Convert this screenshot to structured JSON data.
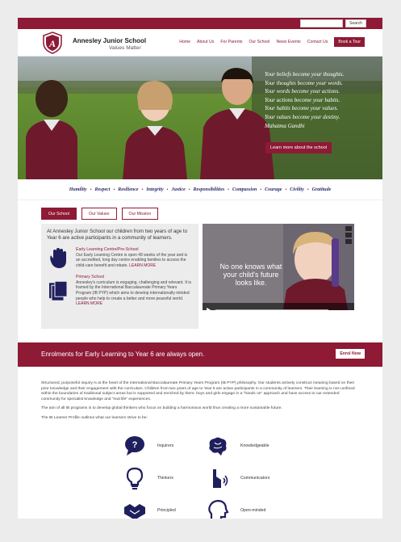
{
  "search": {
    "placeholder": "",
    "button_label": "Search"
  },
  "header": {
    "school_name": "Annesley Junior School",
    "tagline": "Values Matter",
    "crest_letter": "A"
  },
  "nav": {
    "items": [
      "Home",
      "About Us",
      "For Parents",
      "Our School",
      "News Events",
      "Contact Us"
    ],
    "cta_label": "Book a Tour"
  },
  "hero": {
    "quote_lines": [
      "Your beliefs become your thoughts.",
      "Your thoughts become your words.",
      "Your words become your actions.",
      "Your actions become your habits.",
      "Your habits become your values.",
      "Your values become your destiny."
    ],
    "attribution": "Mahatma Gandhi",
    "cta_label": "Learn more about the school"
  },
  "values": [
    "Humility",
    "Respect",
    "Resilience",
    "Integrity",
    "Justice",
    "Responsibilities",
    "Compassion",
    "Courage",
    "Civility",
    "Gratitude"
  ],
  "tabs": [
    "Our School",
    "Our Values",
    "Our Mission"
  ],
  "panel": {
    "intro": "At Annesley Junior School our children from two years of age to Year 6 are active participants in a community of learners.",
    "features": [
      {
        "title": "Early Learning Centre/Pre-School",
        "text": "Our Early Learning Centre is open 49 weeks of the year and is an accredited, long day centre enabling families to access the child-care benefit and rebate.",
        "link": "LEARN MORE",
        "icon": "hand-icon"
      },
      {
        "title": "Primary School",
        "text": "Annesley's curriculum is engaging, challenging and relevant. It is framed by the International Baccalaureate Primary Years Program (IB PYP) which aims to develop internationally minded people who help to create a better and more peaceful world.",
        "link": "LEARN MORE",
        "icon": "books-icon"
      }
    ]
  },
  "video": {
    "caption": "No one knows what your child's future looks like."
  },
  "banner": {
    "text": "Enrolments for Early Learning to Year 6 are always open.",
    "cta_label": "Enrol Now"
  },
  "body": {
    "paragraphs": [
      "Structured, purposeful inquiry is at the heart of the International Baccalaureate Primary Years Program (IB PYP) philosophy. Our students actively construct meaning based on their prior knowledge and their engagement with the curriculum. Children from two years of age to Year 6 are active participants in a community of learners. Their learning is not confined within the boundaries of traditional subject areas but is supported and enriched by them- boys and girls engage in a \"hands on\" approach and have access to our extended community for specialist knowledge and \"real life\" experiences.",
      "The aim of all IB programs is to develop global thinkers who focus on building a harmonious world thus creating a more sustainable future.",
      "The IB Learner Profile outlines what our learners strive to be:"
    ],
    "profile": [
      {
        "label": "Inquirers",
        "icon": "speech-bubble-icon"
      },
      {
        "label": "Knowledgeable",
        "icon": "brain-icon"
      },
      {
        "label": "Thinkers",
        "icon": "lightbulb-icon"
      },
      {
        "label": "Communicators",
        "icon": "megaphone-icon"
      },
      {
        "label": "Principled",
        "icon": "handshake-icon"
      },
      {
        "label": "Open-minded",
        "icon": "head-icon"
      }
    ]
  },
  "colors": {
    "brand": "#8e1a35",
    "navy": "#1f1f5e",
    "panel": "#ececec"
  }
}
